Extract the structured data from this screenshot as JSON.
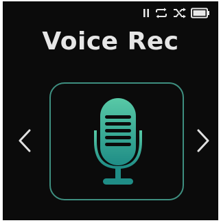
{
  "app": {
    "title": "Voice Rec",
    "icon": "microphone-icon"
  },
  "status": {
    "icons": [
      "pause-icon",
      "repeat-icon",
      "shuffle-icon",
      "battery-icon"
    ]
  },
  "navigation": {
    "previous_icon": "chevron-left-icon",
    "next_icon": "chevron-right-icon"
  },
  "colors": {
    "background": "#0b0b0b",
    "text": "#e6e6e6",
    "accent_light": "#58c9a6",
    "accent_dark": "#1f8d86",
    "tile_border": "#3e8f80"
  }
}
